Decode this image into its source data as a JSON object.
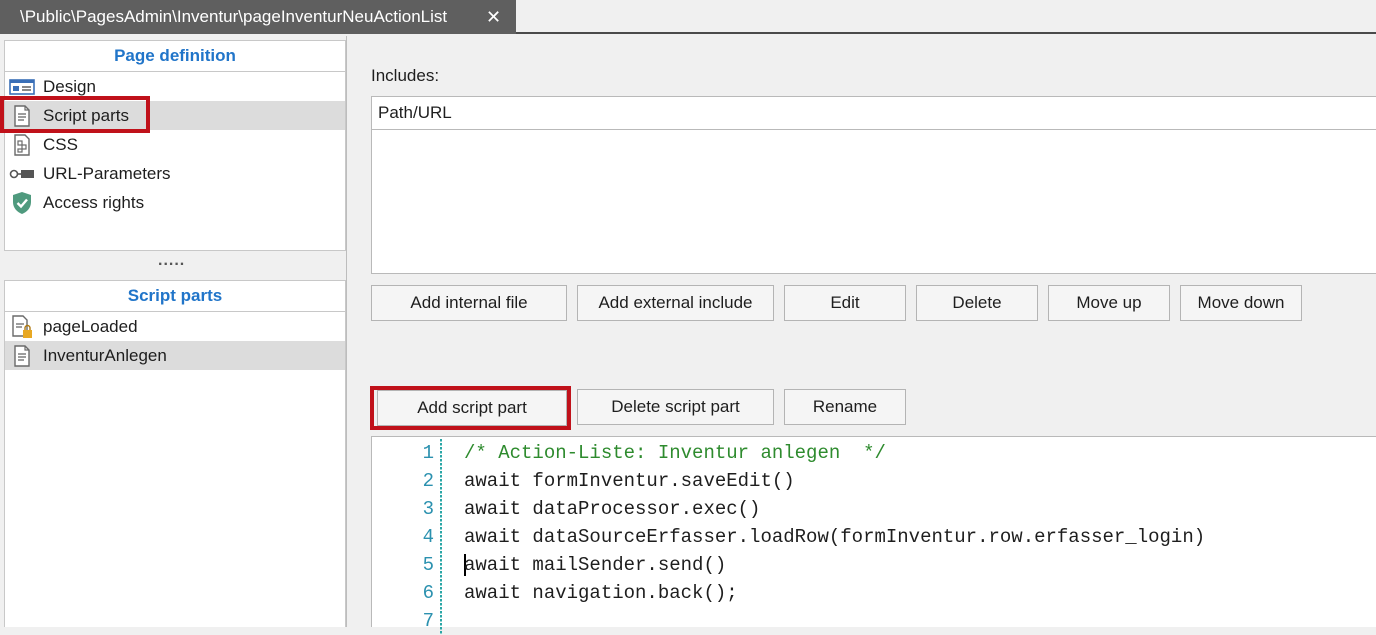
{
  "tab": {
    "title": "\\Public\\PagesAdmin\\Inventur\\pageInventurNeuActionList",
    "close_label": "✕"
  },
  "page_definition": {
    "header": "Page definition",
    "items": [
      {
        "label": "Design",
        "icon": "design-icon"
      },
      {
        "label": "Script parts",
        "icon": "script-icon",
        "selected": true
      },
      {
        "label": "CSS",
        "icon": "css-icon"
      },
      {
        "label": "URL-Parameters",
        "icon": "parameter-icon"
      },
      {
        "label": "Access rights",
        "icon": "shield-check-icon"
      }
    ]
  },
  "splitter": {
    "dots": "....."
  },
  "script_parts": {
    "header": "Script parts",
    "items": [
      {
        "label": "pageLoaded",
        "icon": "script-lock-icon"
      },
      {
        "label": "InventurAnlegen",
        "icon": "script-icon",
        "selected": true
      }
    ]
  },
  "includes": {
    "label": "Includes:",
    "column_header": "Path/URL",
    "rows": []
  },
  "include_buttons": {
    "add_internal": "Add internal file",
    "add_external": "Add external include",
    "edit": "Edit",
    "delete": "Delete",
    "move_up": "Move up",
    "move_down": "Move down"
  },
  "script_buttons": {
    "add": "Add script part",
    "delete": "Delete script part",
    "rename": "Rename"
  },
  "editor": {
    "lines": [
      {
        "n": "1",
        "text": "/* Action-Liste: Inventur anlegen  */",
        "comment": true
      },
      {
        "n": "2",
        "text": "await formInventur.saveEdit()"
      },
      {
        "n": "3",
        "text": "await dataProcessor.exec()"
      },
      {
        "n": "4",
        "text": "await dataSourceErfasser.loadRow(formInventur.row.erfasser_login)"
      },
      {
        "n": "5",
        "text": "await mailSender.send()"
      },
      {
        "n": "6",
        "text": "await navigation.back();"
      },
      {
        "n": "7",
        "text": ""
      }
    ]
  },
  "colors": {
    "accent": "#2175c9",
    "highlight": "#c0111a",
    "comment": "#2e8b2e",
    "line_number": "#2b91af"
  }
}
